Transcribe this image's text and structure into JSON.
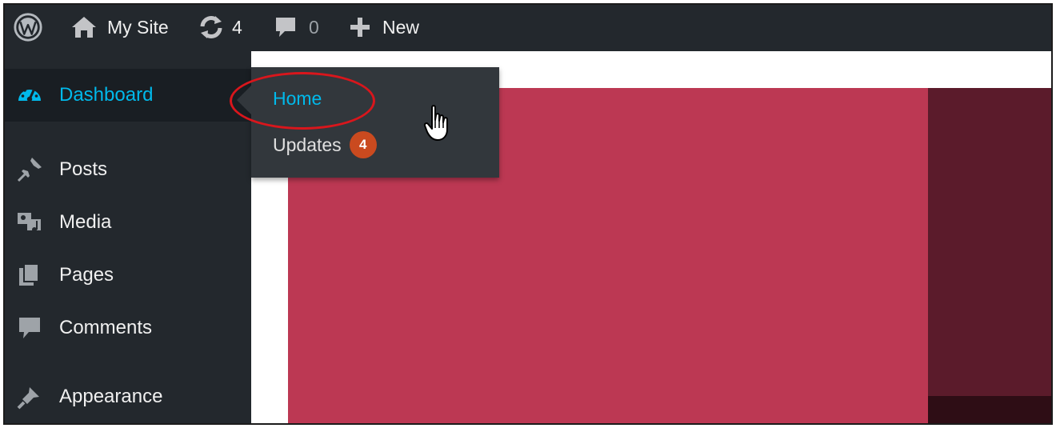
{
  "adminbar": {
    "wp_logo_icon": "wordpress-logo-icon",
    "site_name": "My Site",
    "updates_count": "4",
    "comments_count": "0",
    "new_label": "New"
  },
  "sidebar": {
    "items": [
      {
        "label": "Dashboard",
        "icon": "dashboard-icon",
        "current": true
      },
      {
        "label": "Posts",
        "icon": "pushpin-icon"
      },
      {
        "label": "Media",
        "icon": "media-icon"
      },
      {
        "label": "Pages",
        "icon": "pages-icon"
      },
      {
        "label": "Comments",
        "icon": "comment-icon"
      },
      {
        "label": "Appearance",
        "icon": "paintbrush-icon"
      }
    ]
  },
  "flyout": {
    "home_label": "Home",
    "updates_label": "Updates",
    "updates_badge": "4"
  },
  "colors": {
    "admin_bg": "#23282d",
    "accent": "#00b9eb",
    "badge": "#ca4a1f",
    "hero": "#bc3853",
    "highlight": "#d9161c"
  }
}
